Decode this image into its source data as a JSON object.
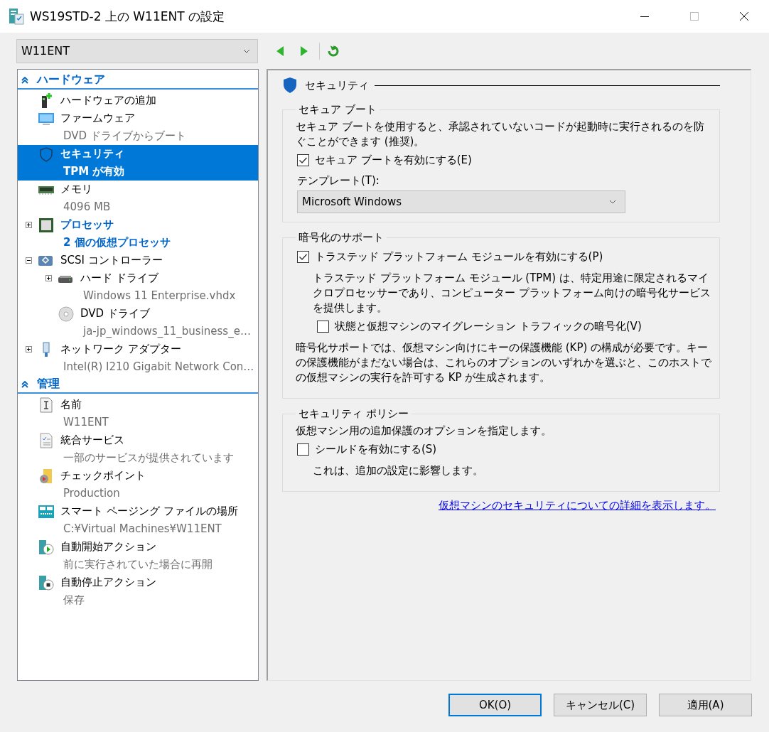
{
  "window": {
    "title": "WS19STD-2 上の W11ENT の設定"
  },
  "vm_selector": {
    "value": "W11ENT"
  },
  "sidebar": {
    "sections": [
      {
        "title": "ハードウェア",
        "expanded": true,
        "items": [
          {
            "kind": "hardware",
            "title": "ハードウェアの追加",
            "selected": false,
            "highlighted": false
          },
          {
            "kind": "firmware",
            "title": "ファームウェア",
            "subtitle": "DVD ドライブからブート",
            "selected": false,
            "highlighted": false
          },
          {
            "kind": "security",
            "title": "セキュリティ",
            "subtitle": "TPM が有効",
            "selected": true,
            "highlighted": false
          },
          {
            "kind": "memory",
            "title": "メモリ",
            "subtitle": "4096 MB",
            "selected": false,
            "highlighted": false
          },
          {
            "kind": "processor",
            "title": "プロセッサ",
            "subtitle": "2 個の仮想プロセッサ",
            "selected": false,
            "highlighted": true,
            "expanded": false
          },
          {
            "kind": "scsi",
            "title": "SCSI コントローラー",
            "selected": false,
            "highlighted": false,
            "expanded": true,
            "children": [
              {
                "kind": "disk",
                "title": "ハード ドライブ",
                "subtitle": "Windows 11 Enterprise.vhdx",
                "selected": false,
                "highlighted": false,
                "expanded": false
              },
              {
                "kind": "dvd",
                "title": "DVD ドライブ",
                "subtitle": "ja-jp_windows_11_business_e…",
                "selected": false,
                "highlighted": false
              }
            ]
          },
          {
            "kind": "network",
            "title": "ネットワーク アダプター",
            "subtitle": "Intel(R) I210 Gigabit Network Con…",
            "selected": false,
            "highlighted": false,
            "expanded": false
          }
        ]
      },
      {
        "title": "管理",
        "expanded": true,
        "items": [
          {
            "kind": "name",
            "title": "名前",
            "subtitle": "W11ENT",
            "selected": false,
            "highlighted": false
          },
          {
            "kind": "services",
            "title": "統合サービス",
            "subtitle": "一部のサービスが提供されています",
            "selected": false,
            "highlighted": false
          },
          {
            "kind": "checkpoint",
            "title": "チェックポイント",
            "subtitle": "Production",
            "selected": false,
            "highlighted": false
          },
          {
            "kind": "paging",
            "title": "スマート ページング ファイルの場所",
            "subtitle": "C:¥Virtual Machines¥W11ENT",
            "selected": false,
            "highlighted": false
          },
          {
            "kind": "autostart",
            "title": "自動開始アクション",
            "subtitle": "前に実行されていた場合に再開",
            "selected": false,
            "highlighted": false
          },
          {
            "kind": "autostop",
            "title": "自動停止アクション",
            "subtitle": "保存",
            "selected": false,
            "highlighted": false
          }
        ]
      }
    ]
  },
  "pane": {
    "title": "セキュリティ",
    "groups": [
      {
        "title": "セキュア ブート",
        "items": [
          {
            "kind": "text",
            "text": "セキュア ブートを使用すると、承認されていないコードが起動時に実行されるのを防ぐことができます (推奨)。"
          },
          {
            "kind": "checkbox",
            "label": "セキュア ブートを有効にする(E)",
            "checked": true
          },
          {
            "kind": "select",
            "label": "テンプレート(T):",
            "value": "Microsoft Windows"
          }
        ]
      },
      {
        "title": "暗号化のサポート",
        "items": [
          {
            "kind": "checkbox",
            "label": "トラステッド プラットフォーム モジュールを有効にする(P)",
            "checked": true
          },
          {
            "kind": "subtext",
            "text": "トラステッド プラットフォーム モジュール (TPM) は、特定用途に限定されるマイクロプロセッサーであり、コンピューター プラットフォーム向けの暗号化サービスを提供します。"
          },
          {
            "kind": "subcheckbox",
            "label": "状態と仮想マシンのマイグレーション トラフィックの暗号化(V)",
            "checked": false
          },
          {
            "kind": "text",
            "text": "暗号化サポートでは、仮想マシン向けにキーの保護機能 (KP) の構成が必要です。キーの保護機能がまだない場合は、これらのオプションのいずれかを選ぶと、このホストでの仮想マシンの実行を許可する KP が生成されます。"
          }
        ]
      },
      {
        "title": "セキュリティ ポリシー",
        "items": [
          {
            "kind": "text",
            "text": "仮想マシン用の追加保護のオプションを指定します。"
          },
          {
            "kind": "checkbox",
            "label": "シールドを有効にする(S)",
            "checked": false
          },
          {
            "kind": "subtext",
            "text": "これは、追加の設定に影響します。"
          }
        ]
      }
    ],
    "link": "仮想マシンのセキュリティについての詳細を表示します。"
  },
  "buttons": [
    {
      "label": "OK(O)",
      "default": true
    },
    {
      "label": "キャンセル(C)",
      "default": false
    },
    {
      "label": "適用(A)",
      "default": false
    }
  ]
}
